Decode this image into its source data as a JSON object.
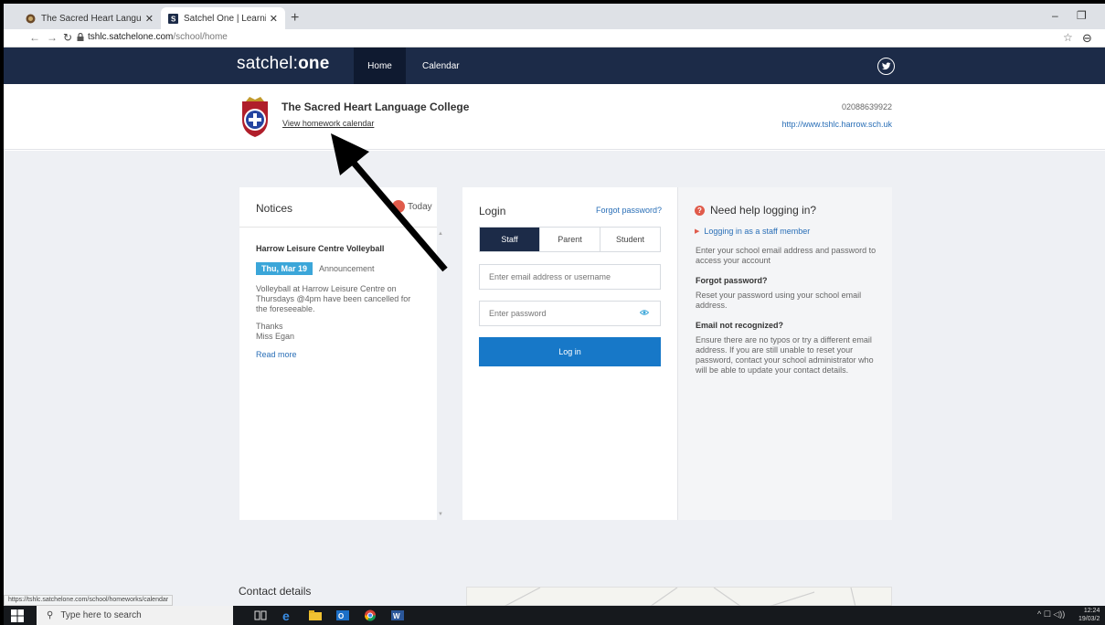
{
  "browser": {
    "tabs": [
      {
        "title": "The Sacred Heart Language Colle",
        "active": false
      },
      {
        "title": "Satchel One | Learning platform",
        "active": true
      }
    ],
    "url_host": "tshlc.satchelone.com",
    "url_path": "/school/home",
    "status_url": "https://tshlc.satchelone.com/school/homeworks/calendar"
  },
  "app": {
    "logo_prefix": "satchel:",
    "logo_bold": "one",
    "nav": {
      "home": "Home",
      "calendar": "Calendar"
    }
  },
  "school": {
    "name": "The Sacred Heart Language College",
    "homework_link": "View homework calendar",
    "phone": "02088639922",
    "website": "http://www.tshlc.harrow.sch.uk"
  },
  "notices": {
    "title": "Notices",
    "today_label": "Today",
    "item": {
      "title": "Harrow Leisure Centre Volleyball",
      "date": "Thu, Mar 19",
      "type": "Announcement",
      "text": "Volleyball at Harrow Leisure Centre on Thursdays @4pm have been cancelled for the foreseeable.",
      "thanks": "Thanks",
      "signature": "Miss Egan",
      "read_more": "Read more"
    }
  },
  "login": {
    "title": "Login",
    "forgot_link": "Forgot password?",
    "roles": [
      "Staff",
      "Parent",
      "Student"
    ],
    "active_role": "Staff",
    "email_placeholder": "Enter email address or username",
    "password_placeholder": "Enter password",
    "button": "Log in"
  },
  "help": {
    "title": "Need help logging in?",
    "staff_link": "Logging in as a staff member",
    "intro": "Enter your school email address and password to access your account",
    "forgot_heading": "Forgot password?",
    "forgot_text": "Reset your password using your school email address.",
    "notrecognized_heading": "Email not recognized?",
    "notrecognized_text": "Ensure there are no typos or try a different email address. If you are still unable to reset your password, contact your school administrator who will be able to update your contact details."
  },
  "contact": {
    "title": "Contact details"
  },
  "taskbar": {
    "search_placeholder": "Type here to search",
    "time": "12:24",
    "date": "19/03/2"
  },
  "colors": {
    "header_navy": "#1c2b48",
    "primary_blue": "#1778c8",
    "link_blue": "#2a6fb7",
    "date_badge": "#3ba6d9",
    "alert_red": "#e05b4b"
  }
}
